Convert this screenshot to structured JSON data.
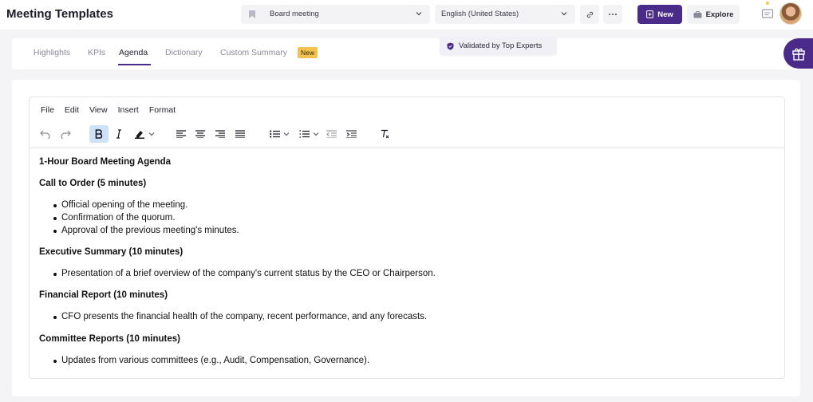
{
  "header": {
    "title": "Meeting Templates",
    "template_select": "Board meeting",
    "language_select": "English (United States)",
    "new_label": "New",
    "explore_label": "Explore"
  },
  "tabs": [
    {
      "label": "Highlights",
      "active": false
    },
    {
      "label": "KPIs",
      "active": false
    },
    {
      "label": "Agenda",
      "active": true
    },
    {
      "label": "Dictionary",
      "active": false
    },
    {
      "label": "Custom Summary",
      "active": false
    }
  ],
  "custom_summary_badge": "New",
  "validated_label": "Validated by Top Experts",
  "editor": {
    "menu": [
      "File",
      "Edit",
      "View",
      "Insert",
      "Format"
    ],
    "toolbar_icons": [
      "undo-icon",
      "redo-icon",
      "bold-icon",
      "italic-icon",
      "highlight-icon",
      "align-left-icon",
      "align-center-icon",
      "align-right-icon",
      "align-justify-icon",
      "bullet-list-icon",
      "numbered-list-icon",
      "outdent-icon",
      "indent-icon",
      "clear-format-icon"
    ],
    "bold_active": true,
    "content": {
      "title": "1-Hour Board Meeting Agenda",
      "sections": [
        {
          "heading": "Call to Order (5 minutes)",
          "items": [
            "Official opening of the meeting.",
            "Confirmation of the quorum.",
            "Approval of the previous meeting's minutes."
          ]
        },
        {
          "heading": "Executive Summary (10 minutes)",
          "items": [
            "Presentation of a brief overview of the company's current status by the CEO or Chairperson."
          ]
        },
        {
          "heading": "Financial Report (10 minutes)",
          "items": [
            "CFO presents the financial health of the company, recent performance, and any forecasts."
          ]
        },
        {
          "heading": "Committee Reports (10 minutes)",
          "items": [
            "Updates from various committees (e.g., Audit, Compensation, Governance)."
          ]
        }
      ]
    }
  },
  "colors": {
    "accent": "#4a2b8a",
    "badge": "#f2c14e",
    "bold_active_bg": "#cfe1f6"
  }
}
